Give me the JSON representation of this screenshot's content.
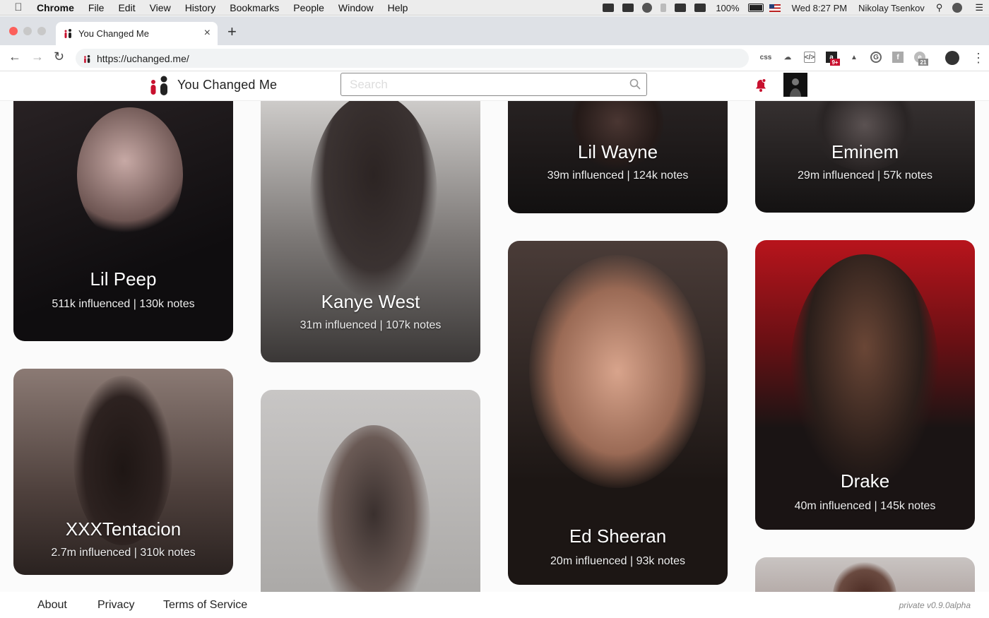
{
  "menubar": {
    "app": "Chrome",
    "items": [
      "File",
      "Edit",
      "View",
      "History",
      "Bookmarks",
      "People",
      "Window",
      "Help"
    ],
    "battery": "100%",
    "datetime": "Wed 8:27 PM",
    "user": "Nikolay Tsenkov"
  },
  "browser": {
    "tab_title": "You Changed Me",
    "url": "https://uchanged.me/",
    "ext_css": "css",
    "ext_badge_1": "9+",
    "ext_badge_2": "21"
  },
  "site": {
    "brand": "You Changed Me",
    "search_placeholder": "Search",
    "accent": "#c8102e"
  },
  "cards": [
    {
      "name": "Lil Peep",
      "stats": "511k influenced | 130k notes"
    },
    {
      "name": "Kanye West",
      "stats": "31m influenced | 107k notes"
    },
    {
      "name": "Lil Wayne",
      "stats": "39m influenced | 124k notes"
    },
    {
      "name": "Eminem",
      "stats": "29m influenced | 57k notes"
    },
    {
      "name": "XXXTentacion",
      "stats": "2.7m influenced | 310k notes"
    },
    {
      "name": "Ed Sheeran",
      "stats": "20m influenced | 93k notes"
    },
    {
      "name": "Drake",
      "stats": "40m influenced | 145k notes"
    }
  ],
  "footer": {
    "about": "About",
    "privacy": "Privacy",
    "terms": "Terms of Service",
    "version": "private v0.9.0alpha"
  }
}
